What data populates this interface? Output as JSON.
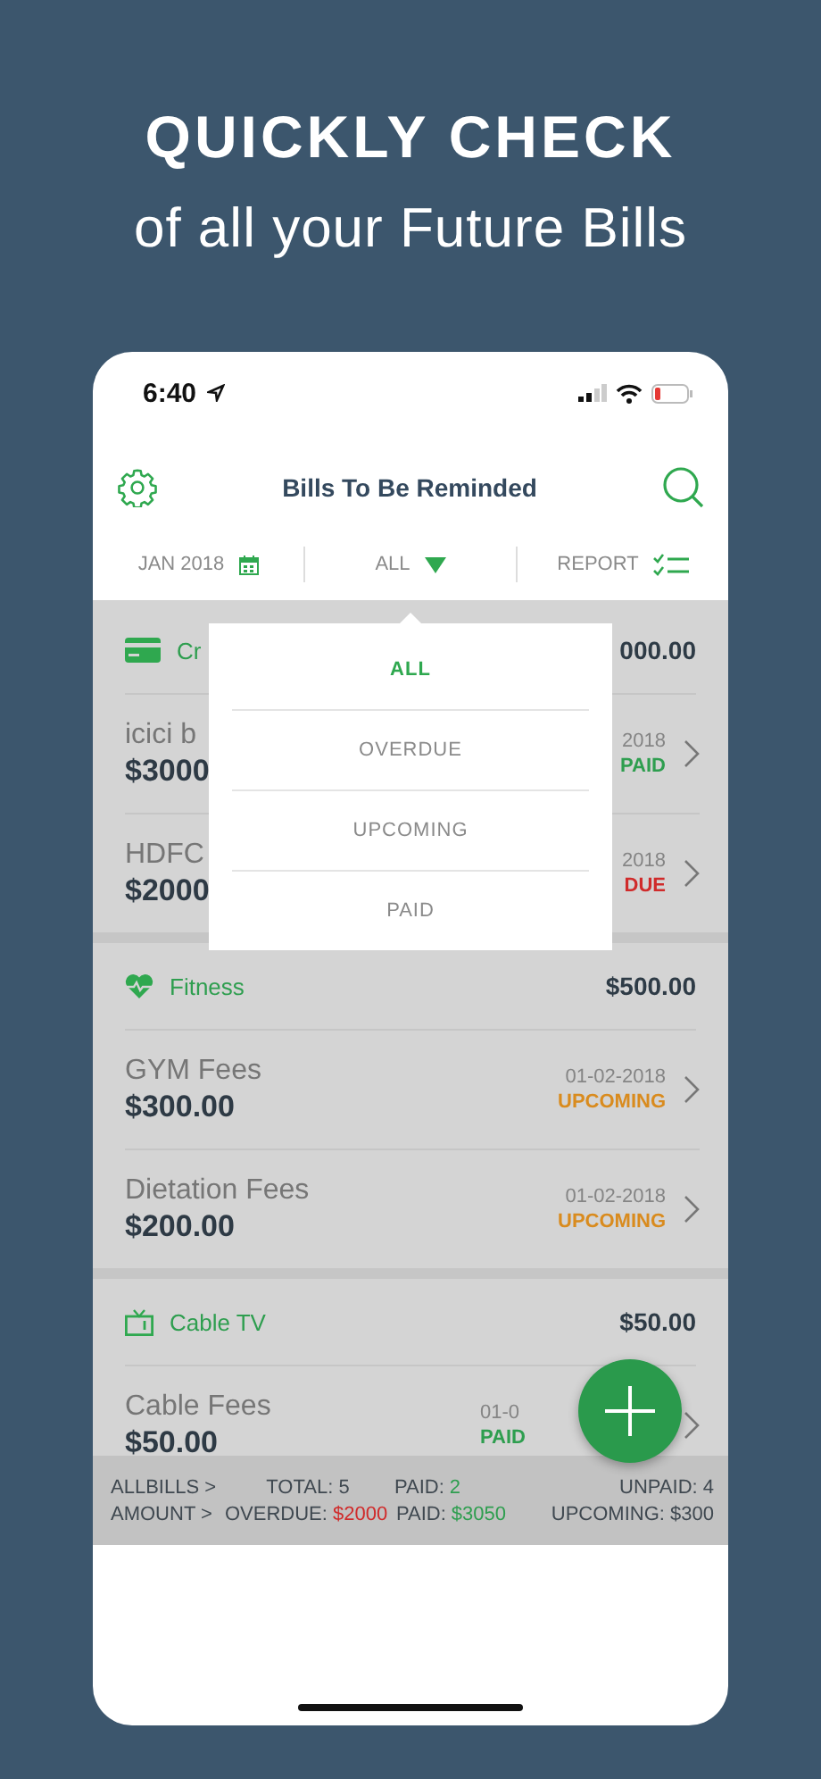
{
  "headline": {
    "title": "QUICKLY CHECK",
    "subtitle": "of all your Future Bills"
  },
  "status_bar": {
    "time": "6:40"
  },
  "nav": {
    "title": "Bills To Be Reminded"
  },
  "filters": [
    {
      "kind": "month",
      "label": "JAN 2018"
    },
    {
      "kind": "dropdown",
      "label": "ALL"
    },
    {
      "kind": "report",
      "label": "REPORT"
    }
  ],
  "dropdown": {
    "options": [
      {
        "label": "ALL",
        "selected": true
      },
      {
        "label": "OVERDUE",
        "selected": false
      },
      {
        "label": "UPCOMING",
        "selected": false
      },
      {
        "label": "PAID",
        "selected": false
      }
    ]
  },
  "groups": [
    {
      "kind": "card",
      "name": "Cr",
      "amount": "000.00",
      "bills": [
        {
          "name": "icici b",
          "amount": "$3000",
          "date": "2018",
          "status": "PAID",
          "color": "#2e9e4f"
        },
        {
          "name": "HDFC",
          "amount": "$2000",
          "date": "2018",
          "status": "DUE",
          "color": "#d02b2b"
        }
      ]
    },
    {
      "kind": "heart",
      "name": "Fitness",
      "amount": "$500.00",
      "bills": [
        {
          "name": "GYM Fees",
          "amount": "$300.00",
          "date": "01-02-2018",
          "status": "UPCOMING",
          "color": "#d98b1e"
        },
        {
          "name": "Dietation Fees",
          "amount": "$200.00",
          "date": "01-02-2018",
          "status": "UPCOMING",
          "color": "#d98b1e"
        }
      ]
    },
    {
      "kind": "tv",
      "name": "Cable TV",
      "amount": "$50.00",
      "bills": [
        {
          "name": "Cable Fees",
          "amount": "$50.00",
          "date": "01-0",
          "status": "PAID",
          "color": "#2e9e4f"
        }
      ]
    }
  ],
  "summary": [
    [
      {
        "label": "ALLBILLS >"
      },
      {
        "label": "TOTAL: 5"
      },
      {
        "label": "PAID:",
        "value": "2",
        "color": "#2e9e4f"
      },
      {
        "label": "UNPAID: 4"
      }
    ],
    [
      {
        "label": "AMOUNT  >"
      },
      {
        "label": "OVERDUE:",
        "value": "$2000",
        "color": "#d02b2b"
      },
      {
        "label": "PAID:",
        "value": "$3050",
        "color": "#2e9e4f"
      },
      {
        "label": "UPCOMING: $300"
      }
    ]
  ]
}
